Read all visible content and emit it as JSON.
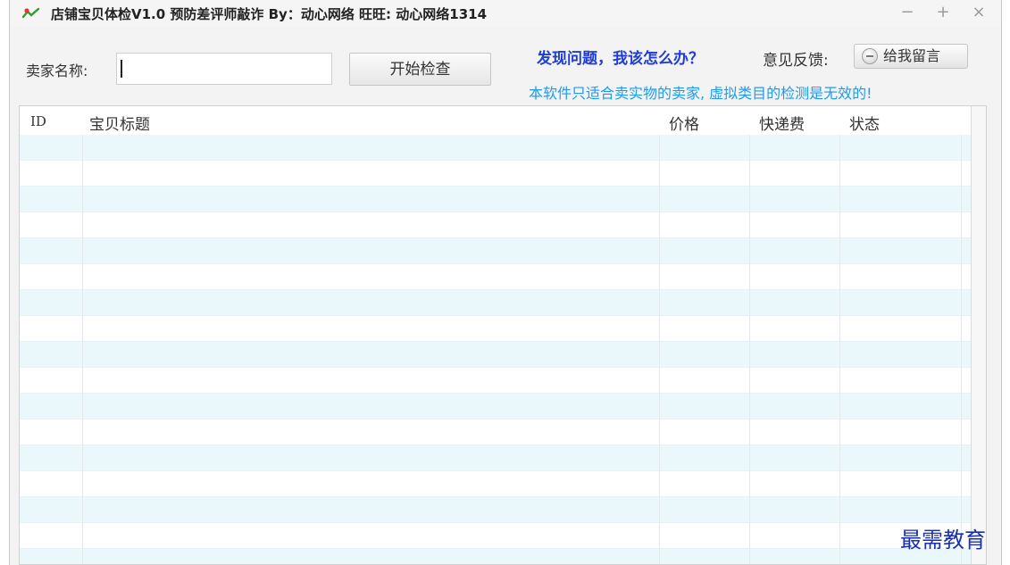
{
  "window": {
    "title": "店铺宝贝体检V1.0  预防差评师敲诈    By：动心网络   旺旺: 动心网络1314",
    "controls": {
      "minimize": "−",
      "maximize": "+",
      "close": "×"
    }
  },
  "toolbar": {
    "seller_label": "卖家名称:",
    "seller_input_value": "",
    "start_button": "开始检查",
    "help_link": "发现问题，我该怎么办？",
    "feedback_label": "意见反馈:",
    "message_button": "给我留言",
    "notice": "本软件只适合卖实物的卖家, 虚拟类目的检测是无效的!"
  },
  "table": {
    "columns": [
      "ID",
      "宝贝标题",
      "价格",
      "快递费",
      "状态"
    ],
    "rows": []
  },
  "watermark": "最需教育"
}
